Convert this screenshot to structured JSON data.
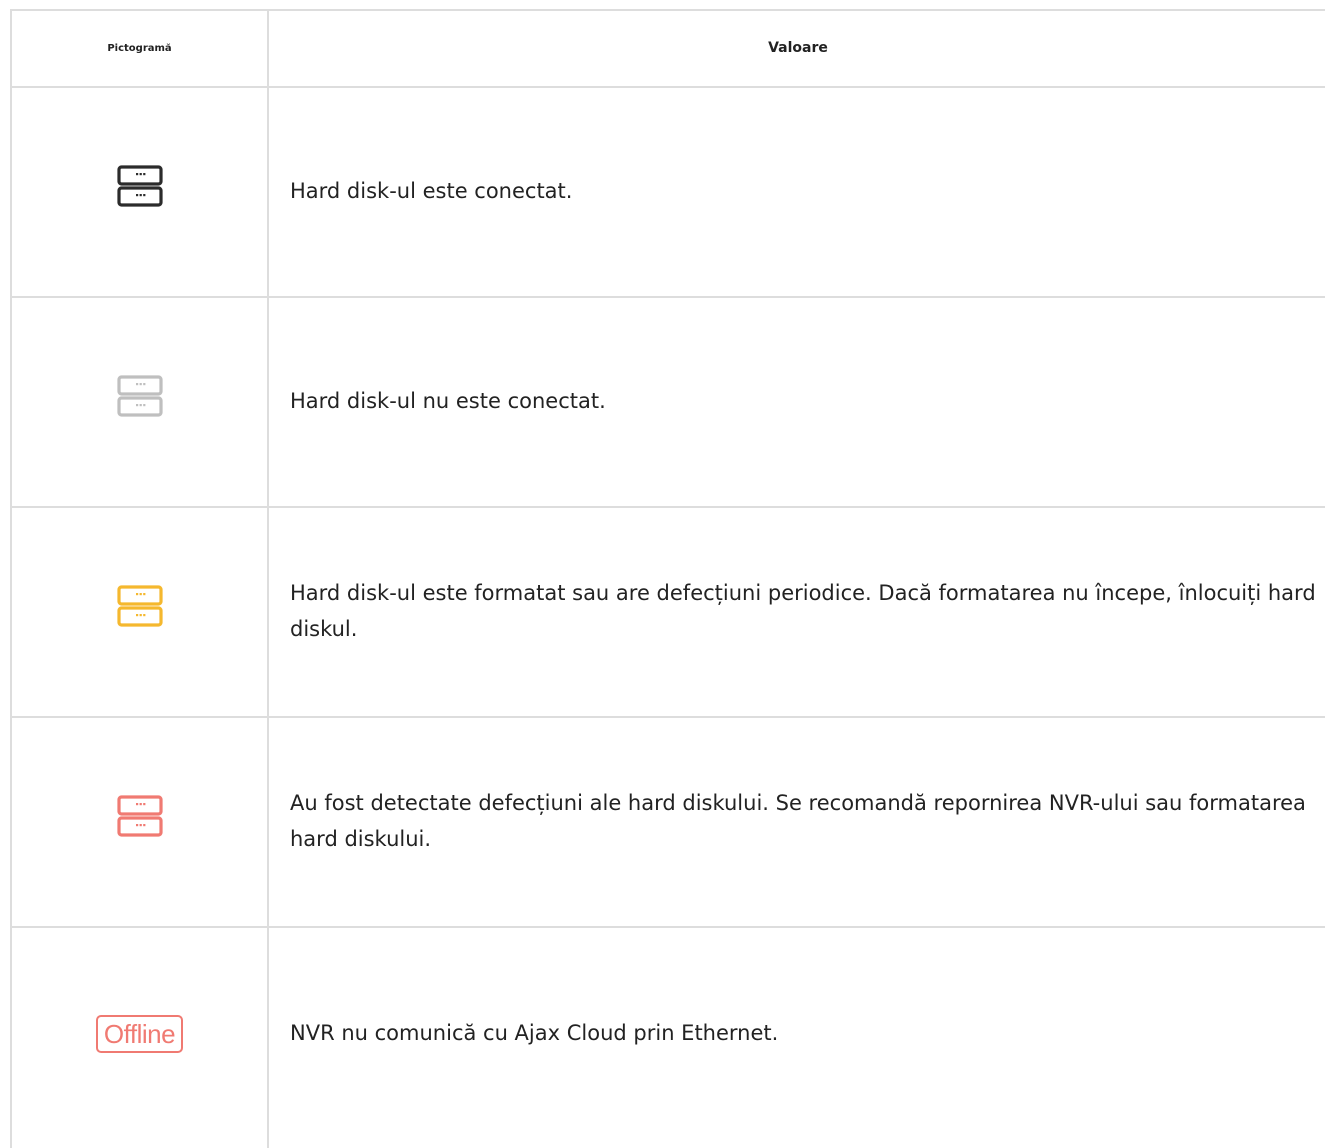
{
  "table": {
    "headers": {
      "icon_column": "Pictogramă",
      "value_column": "Valoare"
    },
    "rows": [
      {
        "icon": "hdd-connected-icon",
        "icon_color": "#2b2b2b",
        "text": "Hard disk-ul este conectat."
      },
      {
        "icon": "hdd-disconnected-icon",
        "icon_color": "#bfbfbf",
        "text": "Hard disk-ul nu este conectat."
      },
      {
        "icon": "hdd-formatting-icon",
        "icon_color": "#f5b82e",
        "text": "Hard disk-ul este formatat sau are defecțiuni periodice. Dacă formatarea nu începe, înlocuiți hard diskul."
      },
      {
        "icon": "hdd-error-icon",
        "icon_color": "#f07a72",
        "text": "Au fost detectate defecțiuni ale hard diskului. Se recomandă repornirea NVR-ului sau formatarea hard diskului."
      },
      {
        "icon": "offline-badge",
        "icon_color": "#f07a72",
        "badge_text": "Offline",
        "text": "NVR nu comunică cu Ajax Cloud prin Ethernet."
      }
    ]
  }
}
